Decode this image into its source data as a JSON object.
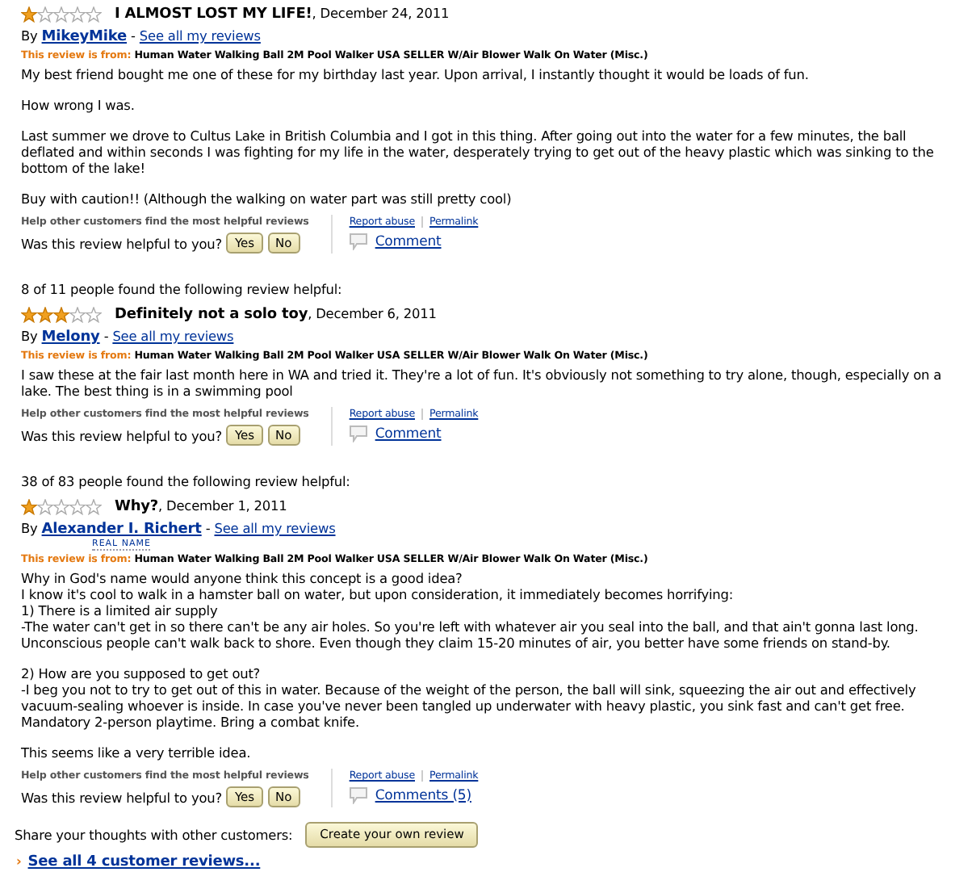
{
  "reviews": [
    {
      "stars": 1,
      "title": "I ALMOST LOST MY LIFE!",
      "date": ", December 24, 2011",
      "by": "By",
      "author": "MikeyMike",
      "sep": "-",
      "see_all": "See all my reviews",
      "from_label": "This review is from:",
      "product": "Human Water Walking Ball 2M Pool Walker USA SELLER W/Air Blower Walk On Water (Misc.)",
      "paragraphs": [
        "My best friend bought me one of these for my birthday last year. Upon arrival, I instantly thought it would be loads of fun.",
        "How wrong I was.",
        "Last summer we drove to Cultus Lake in British Columbia and I got in this thing. After going out into the water for a few minutes, the ball deflated and within seconds I was fighting for my life in the water, desperately trying to get out of the heavy plastic which was sinking to the bottom of the lake!",
        "Buy with caution!! (Although the walking on water part was still pretty cool)"
      ],
      "help_label": "Help other customers find the most helpful reviews",
      "question": "Was this review helpful to you?",
      "yes": "Yes",
      "no": "No",
      "report": "Report abuse",
      "permalink": "Permalink",
      "comment": "Comment"
    },
    {
      "helpful": "8 of 11 people found the following review helpful:",
      "stars": 3,
      "title": "Definitely not a solo toy",
      "date": ", December 6, 2011",
      "by": "By",
      "author": "Melony",
      "sep": "-",
      "see_all": "See all my reviews",
      "from_label": "This review is from:",
      "product": "Human Water Walking Ball 2M Pool Walker USA SELLER W/Air Blower Walk On Water (Misc.)",
      "paragraphs": [
        "I saw these at the fair last month here in WA and tried it. They're a lot of fun. It's obviously not something to try alone, though, especially on a lake. The best thing is in a swimming pool"
      ],
      "help_label": "Help other customers find the most helpful reviews",
      "question": "Was this review helpful to you?",
      "yes": "Yes",
      "no": "No",
      "report": "Report abuse",
      "permalink": "Permalink",
      "comment": "Comment"
    },
    {
      "helpful": "38 of 83 people found the following review helpful:",
      "stars": 1,
      "title": "Why?",
      "date": ", December 1, 2011",
      "by": "By",
      "author": "Alexander I. Richert",
      "sep": "-",
      "see_all": "See all my reviews",
      "real_name": "REAL NAME",
      "from_label": "This review is from:",
      "product": "Human Water Walking Ball 2M Pool Walker USA SELLER W/Air Blower Walk On Water (Misc.)",
      "paragraphs": [
        "Why in God's name would anyone think this concept is a good idea?\nI know it's cool to walk in a hamster ball on water, but upon consideration, it immediately becomes horrifying:\n1) There is a limited air supply\n-The water can't get in so there can't be any air holes. So you're left with whatever air you seal into the ball, and that ain't gonna last long. Unconscious people can't walk back to shore. Even though they claim 15-20 minutes of air, you better have some friends on stand-by.",
        "2) How are you supposed to get out?\n-I beg you not to try to get out of this in water. Because of the weight of the person, the ball will sink, squeezing the air out and effectively vacuum-sealing whoever is inside. In case you've never been tangled up underwater with heavy plastic, you sink fast and can't get free. Mandatory 2-person playtime. Bring a combat knife.",
        "This seems like a very terrible idea."
      ],
      "help_label": "Help other customers find the most helpful reviews",
      "question": "Was this review helpful to you?",
      "yes": "Yes",
      "no": "No",
      "report": "Report abuse",
      "permalink": "Permalink",
      "comment": "Comments (5)"
    }
  ],
  "share": {
    "label": "Share your thoughts with other customers:",
    "button": "Create your own review"
  },
  "see_all": {
    "arrow": "›",
    "label": "See all 4 customer reviews..."
  }
}
